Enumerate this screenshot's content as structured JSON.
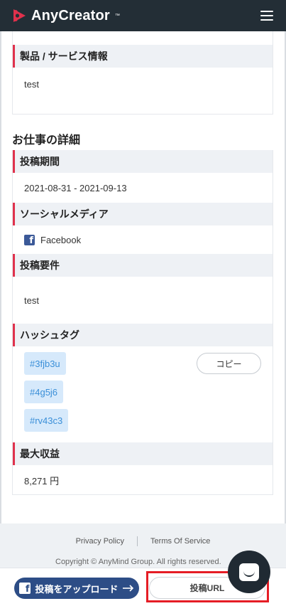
{
  "header": {
    "logo_text": "AnyCreator",
    "logo_tm": "™"
  },
  "product": {
    "heading": "製品 / サービス情報",
    "value": "test"
  },
  "job_details": {
    "title": "お仕事の詳細",
    "period": {
      "heading": "投稿期間",
      "value": "2021-08-31 - 2021-09-13"
    },
    "social": {
      "heading": "ソーシャルメディア",
      "value": "Facebook"
    },
    "requirements": {
      "heading": "投稿要件",
      "value": "test"
    },
    "hashtags": {
      "heading": "ハッシュタグ",
      "tags": [
        "#3fjb3u",
        "#4g5j6",
        "#rv43c3"
      ],
      "copy_label": "コピー"
    },
    "max_earnings": {
      "heading": "最大収益",
      "value": "8,271 円"
    }
  },
  "footer": {
    "privacy": "Privacy Policy",
    "terms": "Terms Of Service",
    "copyright": "Copyright © AnyMind Group. All rights reserved."
  },
  "actions": {
    "upload_label": "投稿をアップロード",
    "url_label": "投稿URL"
  },
  "colors": {
    "header_bg": "#232e36",
    "accent": "#e0314c",
    "tag_bg": "#d6e9fb",
    "tag_text": "#3a8fd8",
    "upload_bg": "#2d4d86",
    "highlight": "#e51d25"
  }
}
